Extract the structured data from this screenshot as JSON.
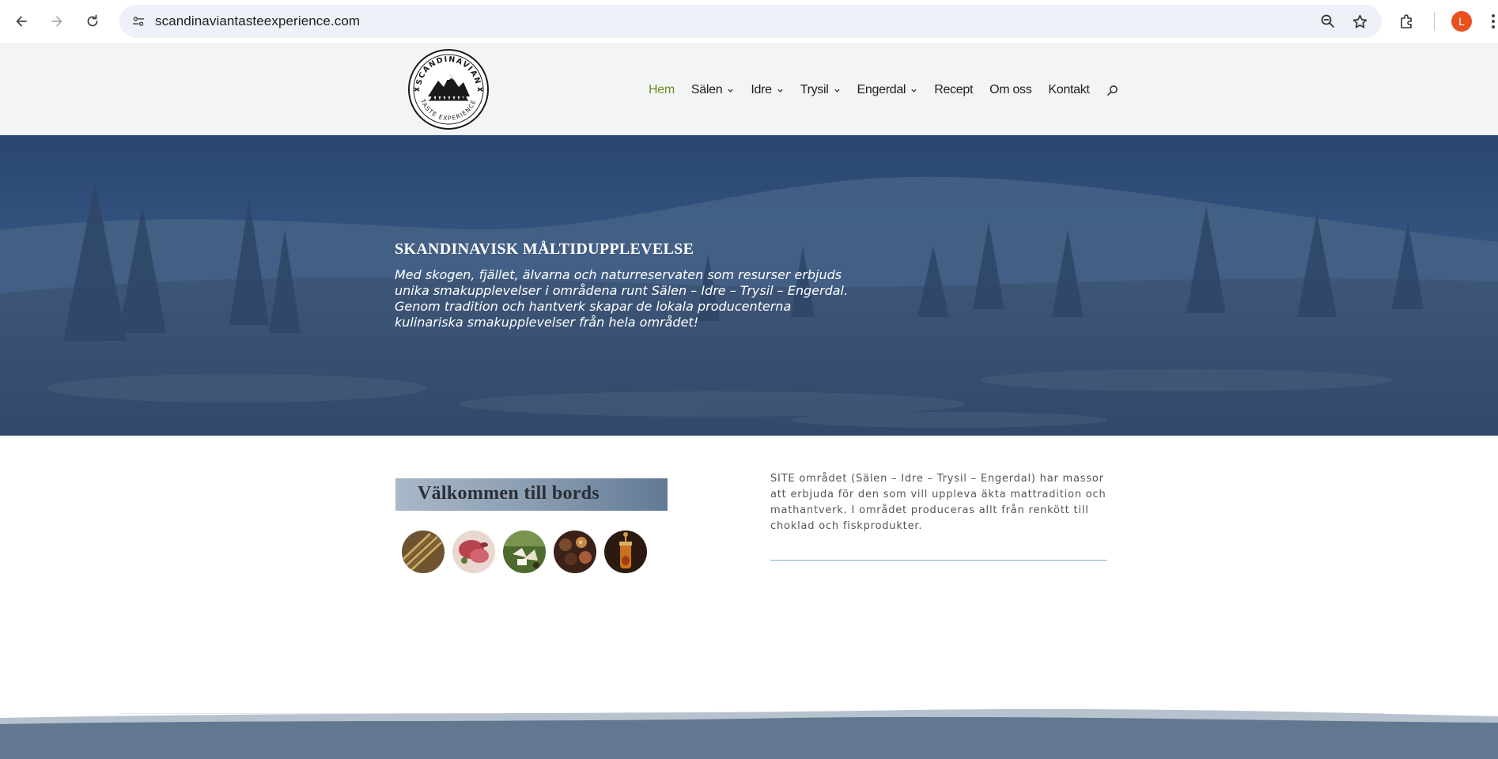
{
  "browser": {
    "url": "scandinaviantasteexperience.com",
    "profile_initial": "L",
    "profile_color": "#e8501e"
  },
  "header": {
    "logo_alt": "SCANDINAVIAN TASTE EXPERIENCE",
    "nav": [
      {
        "label": "Hem",
        "active": true,
        "dropdown": false
      },
      {
        "label": "Sälen",
        "active": false,
        "dropdown": true
      },
      {
        "label": "Idre",
        "active": false,
        "dropdown": true
      },
      {
        "label": "Trysil",
        "active": false,
        "dropdown": true
      },
      {
        "label": "Engerdal",
        "active": false,
        "dropdown": true
      },
      {
        "label": "Recept",
        "active": false,
        "dropdown": false
      },
      {
        "label": "Om oss",
        "active": false,
        "dropdown": false
      },
      {
        "label": "Kontakt",
        "active": false,
        "dropdown": false
      }
    ],
    "active_color": "#6b8e23"
  },
  "hero": {
    "title": "SKANDINAVISK MÅLTIDUPPLEVELSE",
    "lines": [
      "Med skogen, fjället, älvarna och naturreservaten som resurser erbjuds",
      "unika smakupplevelser i områdena runt Sälen – Idre – Trysil – Engerdal.",
      "Genom tradition och hantverk skapar de lokala producenterna",
      "kulinariska smakupplevelser från hela området!"
    ]
  },
  "welcome": {
    "title": "Välkommen till bords",
    "images": [
      "grain-image",
      "meat-image",
      "cheese-image",
      "chocolate-image",
      "honey-image"
    ]
  },
  "info": {
    "lines": [
      "SITE området (Sälen – Idre – Trysil – Engerdal) har massor",
      "att erbjuda för den som vill uppleva äkta mattradition och",
      "mathantverk. I området produceras allt från renkött till",
      "choklad och fiskprodukter."
    ]
  },
  "colors": {
    "hero_overlay": "#2c4a74",
    "footer": "#627890",
    "rule": "#7fb6c4"
  }
}
